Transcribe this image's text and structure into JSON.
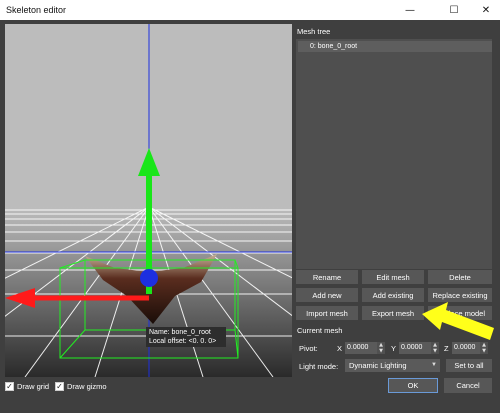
{
  "window": {
    "title": "Skeleton editor",
    "minimize_glyph": "—",
    "maximize_glyph": "☐",
    "close_glyph": "✕"
  },
  "viewport": {
    "tooltip_name": "Name: bone_0_root",
    "tooltip_offset": "Local offset: <0. 0. 0>"
  },
  "mesh_tree": {
    "label": "Mesh tree",
    "items": [
      "0: bone_0_root"
    ]
  },
  "buttons": {
    "rename": "Rename",
    "edit_mesh": "Edit mesh",
    "delete": "Delete",
    "add_new": "Add new",
    "add_existing": "Add existing",
    "replace_existing": "Replace existing",
    "import_mesh": "Import mesh",
    "export_mesh": "Export mesh",
    "replace_model": "Replace model",
    "set_to_all": "Set to all",
    "ok": "OK",
    "cancel": "Cancel"
  },
  "current_mesh": {
    "label": "Current mesh",
    "pivot_label": "Pivot:",
    "x_label": "X",
    "x_value": "0.0000",
    "y_label": "Y",
    "y_value": "0.0000",
    "z_label": "Z",
    "z_value": "0.0000",
    "light_mode_label": "Light mode:",
    "light_mode_value": "Dynamic Lighting"
  },
  "bottom": {
    "draw_grid_label": "Draw grid",
    "draw_grid_checked": true,
    "draw_gizmo_label": "Draw gizmo",
    "draw_gizmo_checked": true
  },
  "colors": {
    "panel_bg": "#3f3f3f",
    "viewport_bg": "#bcbcbc",
    "gizmo_x": "#ff1a1a",
    "gizmo_y": "#19e619",
    "gizmo_z": "#1d2fe0",
    "annotation_arrow": "#ffff1a"
  }
}
